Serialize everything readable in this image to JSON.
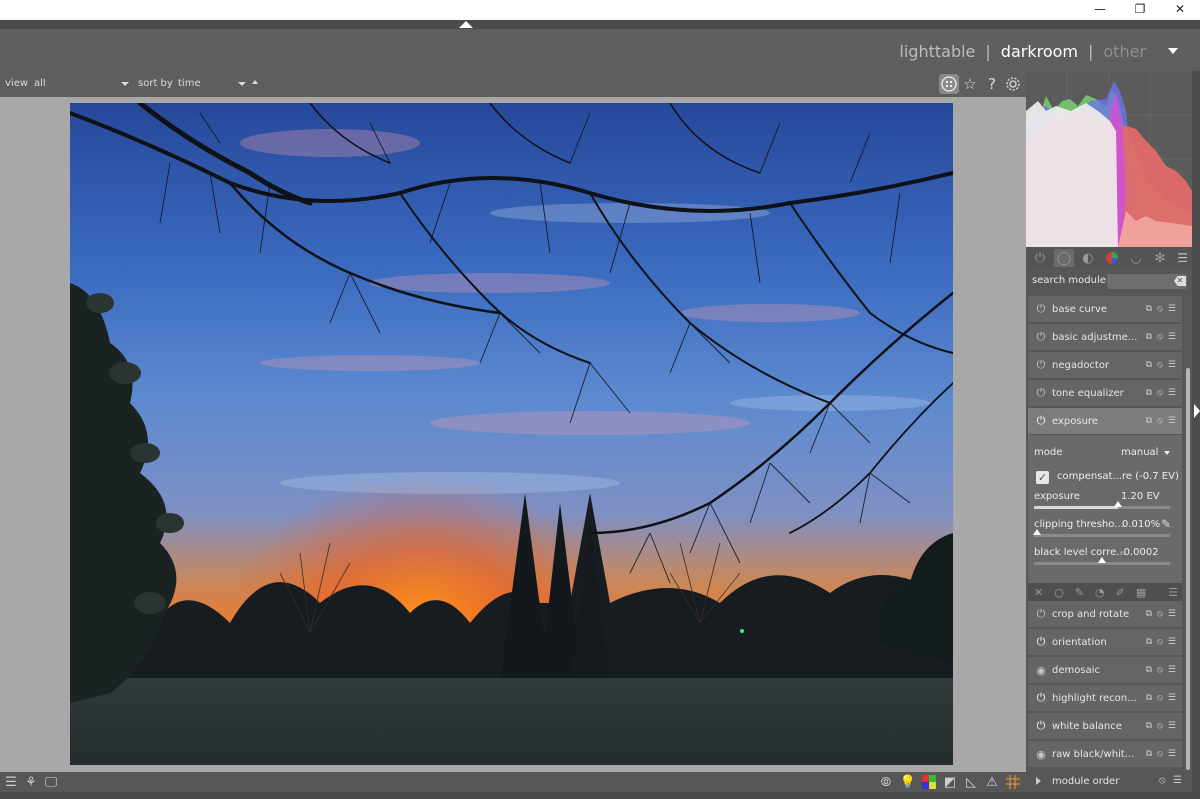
{
  "window": {
    "minimize_glyph": "—",
    "restore_glyph": "❐",
    "close_glyph": "✕"
  },
  "header": {
    "views": [
      {
        "label": "lighttable"
      },
      {
        "label": "darkroom"
      },
      {
        "label": "other"
      }
    ],
    "separator": "|"
  },
  "filterbar": {
    "view_label": "view",
    "view_value": "all",
    "sort_label": "sort by",
    "sort_value": "time",
    "icons": [
      "grid-icon",
      "star-icon",
      "help-icon",
      "gear-icon"
    ]
  },
  "histogram": {
    "colors": {
      "red": "#e36a6a",
      "green": "#7ccf6e",
      "blue": "#6c74e6",
      "magenta": "#d050d8",
      "white": "#eeeeee"
    }
  },
  "module_groups": {
    "icons": [
      "power-icon",
      "circle-icon",
      "tone-icon",
      "color-icon",
      "correct-icon",
      "effect-icon",
      "menu-icon"
    ]
  },
  "search": {
    "label": "search module",
    "placeholder": ""
  },
  "modules_top": [
    {
      "name": "base curve"
    },
    {
      "name": "basic adjustme..."
    },
    {
      "name": "negadoctor"
    },
    {
      "name": "tone equalizer"
    },
    {
      "name": "exposure"
    }
  ],
  "exposure_panel": {
    "mode_label": "mode",
    "mode_value": "manual",
    "compensate_label": "compensat...re (-0.7 EV)",
    "compensate_checked": true,
    "exposure_label": "exposure",
    "exposure_value": "1.20 EV",
    "exposure_fraction": 0.62,
    "clipping_label": "clipping thresho...",
    "clipping_value": "0.010%",
    "clipping_fraction": 0.02,
    "black_label": "black level corre...",
    "black_value": "-0.0002",
    "black_fraction": 0.5
  },
  "modules_bottom": [
    {
      "name": "crop and rotate"
    },
    {
      "name": "orientation"
    },
    {
      "name": "demosaic"
    },
    {
      "name": "highlight recon..."
    },
    {
      "name": "white balance"
    },
    {
      "name": "raw black/whit..."
    }
  ],
  "module_order": {
    "label": "module order"
  },
  "bottombar": {
    "left_icons": [
      "menu-icon",
      "styles-icon",
      "display-icon"
    ],
    "right_icons": [
      "focus-peaking-icon",
      "bulb-icon",
      "color-assessment-icon",
      "softproof-icon",
      "gamut-icon",
      "warning-icon",
      "raw-overexposed-icon"
    ]
  }
}
